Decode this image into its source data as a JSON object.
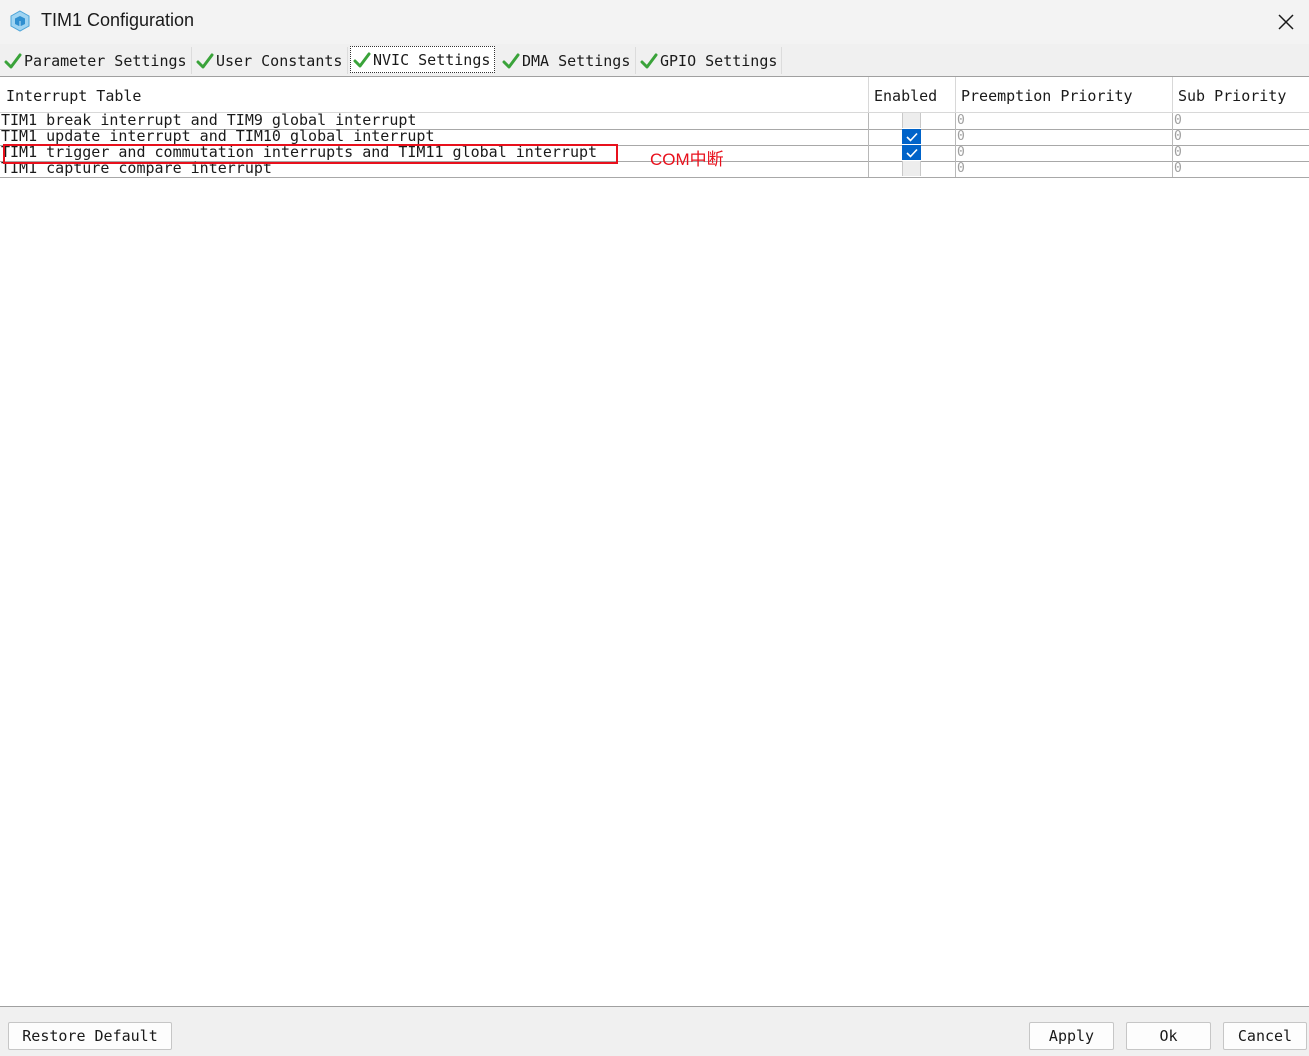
{
  "window": {
    "title": "TIM1 Configuration",
    "close_icon": "close-icon",
    "app_icon": "cube-icon"
  },
  "tabs": [
    {
      "label": "Parameter Settings",
      "icon": "check-icon",
      "active": false
    },
    {
      "label": "User Constants",
      "icon": "check-icon",
      "active": false
    },
    {
      "label": "NVIC Settings",
      "icon": "check-icon",
      "active": true
    },
    {
      "label": "DMA Settings",
      "icon": "check-icon",
      "active": false
    },
    {
      "label": "GPIO Settings",
      "icon": "check-icon",
      "active": false
    }
  ],
  "table": {
    "headers": [
      "Interrupt Table",
      "Enabled",
      "Preemption Priority",
      "Sub Priority"
    ],
    "rows": [
      {
        "name": "TIM1 break interrupt and TIM9 global interrupt",
        "enabled": false,
        "preemption": "0",
        "sub": "0"
      },
      {
        "name": "TIM1 update interrupt and TIM10 global interrupt",
        "enabled": true,
        "preemption": "0",
        "sub": "0"
      },
      {
        "name": "TIM1 trigger and commutation interrupts and TIM11 global interrupt",
        "enabled": true,
        "preemption": "0",
        "sub": "0"
      },
      {
        "name": "TIM1 capture compare interrupt",
        "enabled": false,
        "preemption": "0",
        "sub": "0"
      }
    ]
  },
  "annotation": {
    "text": "COM中断",
    "color": "#e8101c"
  },
  "footer": {
    "restore_label": "Restore Default",
    "apply_label": "Apply",
    "ok_label": "Ok",
    "cancel_label": "Cancel"
  },
  "colors": {
    "check_green": "#3aa33a",
    "checkbox_blue": "#0063c9"
  }
}
